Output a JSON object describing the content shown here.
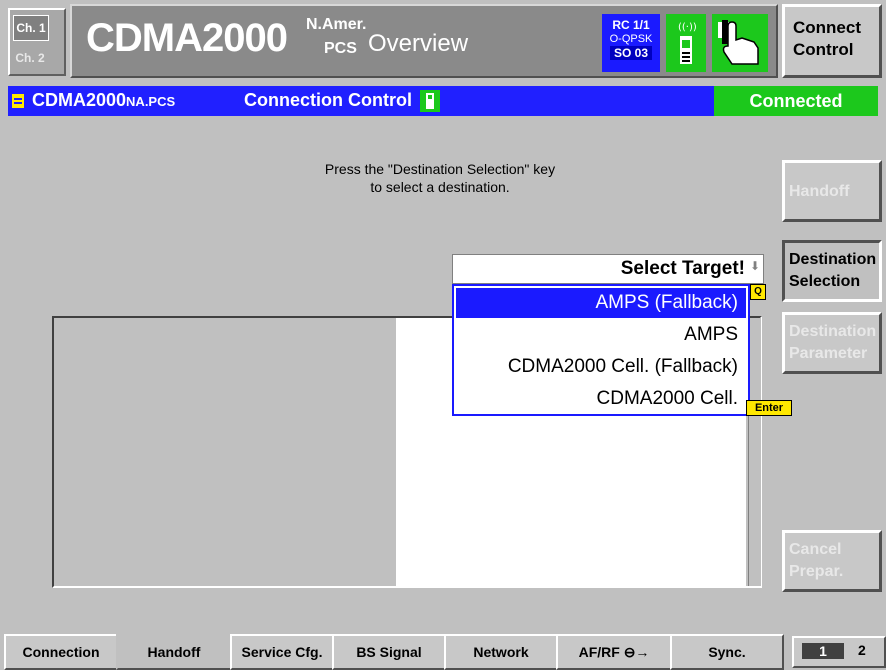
{
  "header": {
    "ch1": "Ch. 1",
    "ch2": "Ch. 2",
    "title": "CDMA2000",
    "region_sup": "N.Amer.",
    "region_sub": "PCS",
    "view": "Overview",
    "rc": "RC 1/1",
    "modulation": "O-QPSK",
    "so": "SO 03",
    "connect_control": [
      "Connect",
      "Control"
    ]
  },
  "status": {
    "app": "CDMA2000",
    "app_suffix": "NA.PCS",
    "function": "Connection Control",
    "state": "Connected"
  },
  "main": {
    "instruction_line1": "Press the \"Destination Selection\" key",
    "instruction_line2": "to select a destination."
  },
  "target": {
    "title": "Select Target!",
    "items": [
      "AMPS (Fallback)",
      "AMPS",
      "CDMA2000 Cell. (Fallback)",
      "CDMA2000 Cell."
    ],
    "selected_index": 0,
    "key_q": "Q",
    "key_enter": "Enter"
  },
  "softkeys": {
    "handoff": "Handoff",
    "dest_sel_1": "Destination",
    "dest_sel_2": "Selection",
    "dest_par_1": "Destination",
    "dest_par_2": "Parameter",
    "cancel_1": "Cancel",
    "cancel_2": "Prepar."
  },
  "tabs": [
    "Connection",
    "Handoff",
    "Service Cfg.",
    "BS Signal",
    "Network",
    "AF/RF",
    "Sync."
  ],
  "active_tab": "Handoff",
  "pages": {
    "p1": "1",
    "p2": "2"
  }
}
